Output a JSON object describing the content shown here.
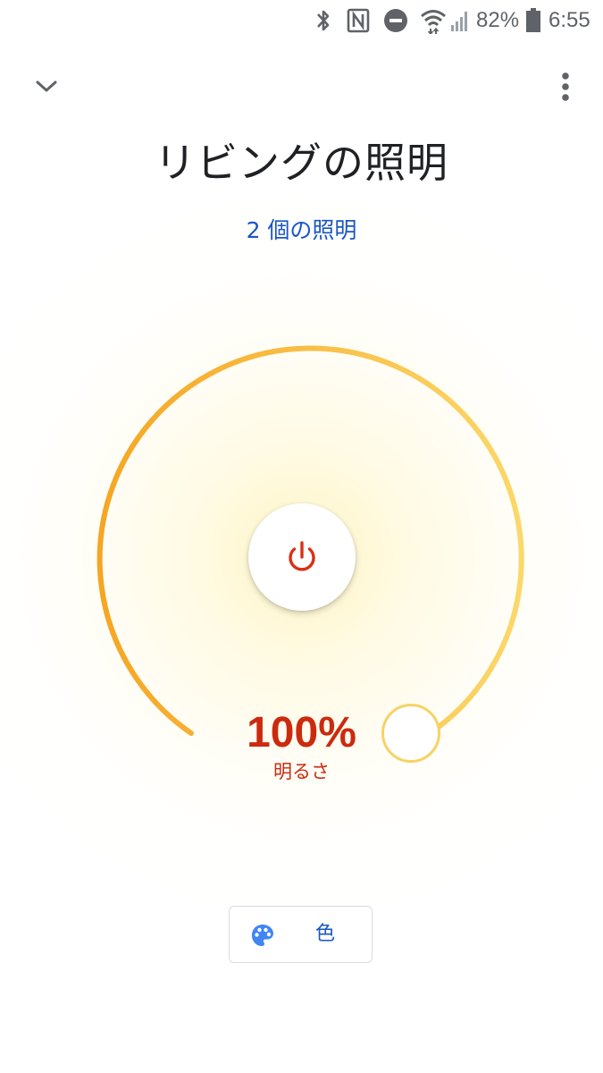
{
  "status_bar": {
    "battery_percent": "82%",
    "time": "6:55",
    "icons": [
      "bluetooth-icon",
      "nfc-icon",
      "do-not-disturb-icon",
      "wifi-icon",
      "signal-icon",
      "battery-icon"
    ]
  },
  "header": {
    "collapse_icon": "chevron-down-icon",
    "menu_icon": "more-vert-icon",
    "title": "リビングの照明",
    "subtitle": "2 個の照明"
  },
  "dial": {
    "brightness_value": "100%",
    "brightness_label": "明るさ",
    "brightness_level": 1.0,
    "power_icon": "power-icon",
    "colors": {
      "arc_start": "#f5a623",
      "arc_end": "#fbd86a",
      "value_text": "#cc2a0e",
      "power_icon": "#d93018"
    }
  },
  "color_button": {
    "icon": "palette-icon",
    "label": "色"
  },
  "accent": "#1a56c4"
}
